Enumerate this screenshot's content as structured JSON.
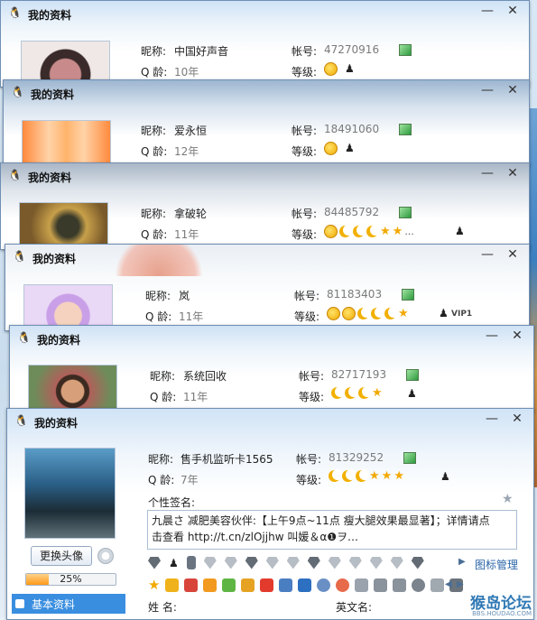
{
  "windows": [
    {
      "title": "我的资料",
      "minimize": "—",
      "close": "✕",
      "nickname_label": "昵称:",
      "nickname": "中国好声音",
      "qage_label": "Q 龄:",
      "qage": "10年",
      "account_label": "帐号:",
      "account": "47270916",
      "level_label": "等级:"
    },
    {
      "title": "我的资料",
      "minimize": "—",
      "close": "✕",
      "nickname_label": "昵称:",
      "nickname": "爱永恒",
      "qage_label": "Q 龄:",
      "qage": "12年",
      "account_label": "帐号:",
      "account": "18491060",
      "level_label": "等级:"
    },
    {
      "title": "我的资料",
      "minimize": "—",
      "close": "✕",
      "nickname_label": "昵称:",
      "nickname": "拿破轮",
      "qage_label": "Q 龄:",
      "qage": "11年",
      "account_label": "帐号:",
      "account": "84485792",
      "level_label": "等级:",
      "level_more": "..."
    },
    {
      "title": "我的资料",
      "minimize": "—",
      "close": "✕",
      "nickname_label": "昵称:",
      "nickname": "岚",
      "qage_label": "Q 龄:",
      "qage": "11年",
      "account_label": "帐号:",
      "account": "81183403",
      "level_label": "等级:",
      "vip": "VIP1"
    },
    {
      "title": "我的资料",
      "minimize": "—",
      "close": "✕",
      "nickname_label": "昵称:",
      "nickname": "系统回收",
      "qage_label": "Q 龄:",
      "qage": "11年",
      "account_label": "帐号:",
      "account": "82717193",
      "level_label": "等级:"
    },
    {
      "title": "我的资料",
      "minimize": "—",
      "close": "✕",
      "nickname_label": "昵称:",
      "nickname": "售手机监听卡1565",
      "qage_label": "Q 龄:",
      "qage": "7年",
      "account_label": "帐号:",
      "account": "81329252",
      "level_label": "等级:"
    }
  ],
  "main": {
    "signature_label": "个性签名:",
    "signature_line1": "九晨さ 减肥美容伙伴:【上午9点~11点 瘦大腿效果最显著】；详情请点",
    "signature_line2": "击查看 http://t.cn/zlOjjhw      叫媛＆α❶ヲ…",
    "change_avatar": "更换头像",
    "progress_text": "25%",
    "progress_value": 0.25,
    "icon_manage": "图标管理",
    "nav_basic": "基本资料",
    "name_label": "姓  名:",
    "english_name_label": "英文名:"
  },
  "watermark": {
    "text": "猴岛论坛",
    "url": "BBS.HOUDAO.COM"
  },
  "colors": {
    "accent": "#3a8ee0",
    "progress": "#ff9a19",
    "link": "#2a64a8"
  }
}
